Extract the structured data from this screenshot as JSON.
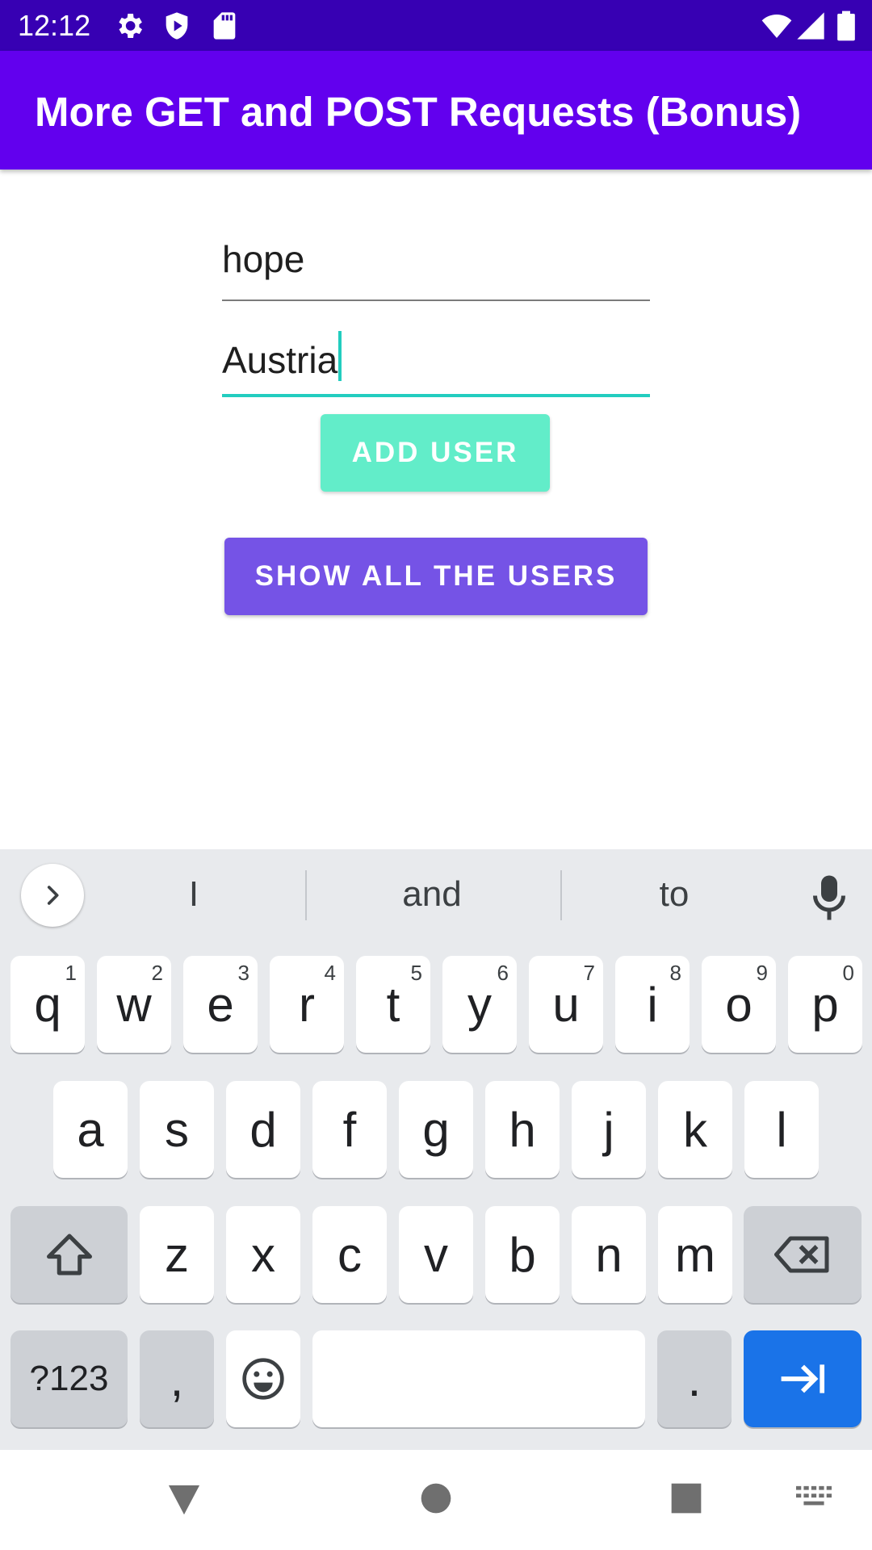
{
  "status_bar": {
    "time": "12:12",
    "left_icons": [
      "settings-icon",
      "shield-icon",
      "sd-card-icon"
    ],
    "right_icons": [
      "wifi-icon",
      "cell-signal-icon",
      "battery-icon"
    ],
    "background_color": "#3700b3"
  },
  "app_bar": {
    "title": "More GET and POST Requests (Bonus)",
    "background_color": "#6200ee"
  },
  "form": {
    "name_field": {
      "value": "hope"
    },
    "country_field": {
      "value": "Austria",
      "focused": true
    },
    "add_button_label": "ADD USER",
    "show_button_label": "SHOW ALL THE USERS",
    "accent_color": "#22cdbf"
  },
  "keyboard": {
    "suggestions": [
      "I",
      "and",
      "to"
    ],
    "rows": [
      [
        {
          "label": "q",
          "hint": "1"
        },
        {
          "label": "w",
          "hint": "2"
        },
        {
          "label": "e",
          "hint": "3"
        },
        {
          "label": "r",
          "hint": "4"
        },
        {
          "label": "t",
          "hint": "5"
        },
        {
          "label": "y",
          "hint": "6"
        },
        {
          "label": "u",
          "hint": "7"
        },
        {
          "label": "i",
          "hint": "8"
        },
        {
          "label": "o",
          "hint": "9"
        },
        {
          "label": "p",
          "hint": "0"
        }
      ],
      [
        {
          "label": "a"
        },
        {
          "label": "s"
        },
        {
          "label": "d"
        },
        {
          "label": "f"
        },
        {
          "label": "g"
        },
        {
          "label": "h"
        },
        {
          "label": "j"
        },
        {
          "label": "k"
        },
        {
          "label": "l"
        }
      ],
      [
        {
          "label": "z"
        },
        {
          "label": "x"
        },
        {
          "label": "c"
        },
        {
          "label": "v"
        },
        {
          "label": "b"
        },
        {
          "label": "n"
        },
        {
          "label": "m"
        }
      ]
    ],
    "symbols_label": "?123",
    "comma_label": ",",
    "period_label": ".",
    "enter_color": "#1a73e8"
  },
  "nav_bar": {
    "icons": [
      "back-icon",
      "home-icon",
      "recents-icon",
      "keyboard-switch-icon"
    ]
  }
}
